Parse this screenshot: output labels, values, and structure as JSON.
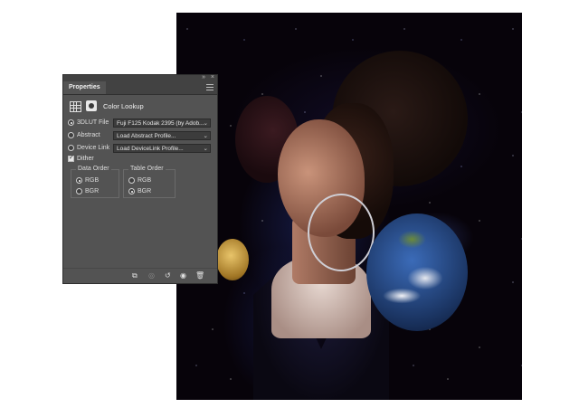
{
  "panel": {
    "tab": "Properties",
    "topbar": {
      "collapse_icon": "double-chevron-icon",
      "close_icon": "close-icon"
    },
    "menu_icon": "hamburger-menu-icon",
    "header": {
      "grid_icon": "lookup-table-icon",
      "mask_icon": "layer-mask-icon",
      "title": "Color Lookup"
    },
    "rows": [
      {
        "label": "3DLUT File",
        "value": "Fuji F125 Kodak 2395 (by Adob...",
        "selected": true
      },
      {
        "label": "Abstract",
        "value": "Load Abstract Profile...",
        "selected": false
      },
      {
        "label": "Device Link",
        "value": "Load DeviceLink Profile...",
        "selected": false
      }
    ],
    "dither": {
      "label": "Dither",
      "checked": true
    },
    "data_order": {
      "title": "Data Order",
      "options": [
        "RGB",
        "BGR"
      ],
      "selected": "RGB"
    },
    "table_order": {
      "title": "Table Order",
      "options": [
        "RGB",
        "BGR"
      ],
      "selected": "BGR"
    },
    "footer_icons": [
      "clip-to-layer-icon",
      "view-previous-state-icon",
      "reset-icon",
      "visibility-eye-icon",
      "trash-icon"
    ]
  },
  "canvas": {
    "elements": [
      "starry-space-background",
      "dark-planet",
      "woman-portrait",
      "hoop-earring",
      "moon",
      "earth-planet"
    ]
  }
}
